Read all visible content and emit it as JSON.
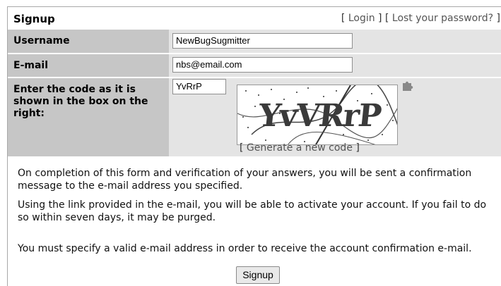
{
  "header": {
    "title": "Signup",
    "login_link": "Login",
    "lost_password_link": "Lost your password?"
  },
  "form": {
    "username_label": "Username",
    "username_value": "NewBugSugmitter",
    "email_label": "E-mail",
    "email_value": "nbs@email.com",
    "captcha_label": "Enter the code as it is shown in the box on the right:",
    "captcha_value": "YvRrP",
    "captcha_image_text": "YvVRrP",
    "generate_link": "Generate a new code"
  },
  "info": {
    "paragraph1": "On completion of this form and verification of your answers, you will be sent a confirmation message to the e-mail address you specified.",
    "paragraph2": "Using the link provided in the e-mail, you will be able to activate your account. If you fail to do so within seven days, it may be purged.",
    "paragraph3": "You must specify a valid e-mail address in order to receive the account confirmation e-mail."
  },
  "submit_label": "Signup",
  "colors": {
    "label_bg": "#c6c6c6",
    "value_bg": "#e4e4e4",
    "link": "#555555"
  },
  "icons": {
    "puzzle": "puzzle-icon"
  }
}
